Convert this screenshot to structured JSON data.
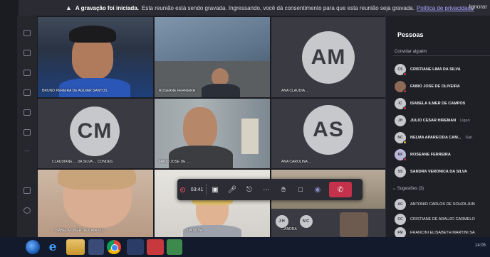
{
  "recording_bar": {
    "title": "A gravação foi iniciada.",
    "message": "Esta reunião está sendo gravada. Ingressando, você dá consentimento para que esta reunião seja gravada.",
    "privacy_link": "Política de privacidade",
    "dismiss": "Ignorar"
  },
  "tiles": [
    {
      "name": "BRUNO PEREIRA DE AGUIAR SANTOS"
    },
    {
      "name": "ROSEANE FERREIRA"
    },
    {
      "name": "ANA CLAUDIA ...",
      "initials": "AM"
    },
    {
      "name": "CLAUDIANE ... DA SILVA ... CONDES",
      "initials": "CM"
    },
    {
      "name": "FABIO JOSE DE ...",
      "initials": ""
    },
    {
      "name": "ANA CAROLINA ...",
      "initials": "AS"
    },
    {
      "name": "ISABELA ILMER DE CAMPOS"
    },
    {
      "name": "... DA SILVA"
    },
    {
      "name": "...ANDRA",
      "initials": "JH",
      "initials2": "NC"
    }
  ],
  "toolbar": {
    "timer": "03:41"
  },
  "people": {
    "title": "Pessoas",
    "invite": "Convidar alguém",
    "participants": [
      {
        "initials": "CS",
        "name": "CRISTIANE LIMA DA SILVA",
        "extra": ""
      },
      {
        "initials": "",
        "name": "FABIO JOSE DE OLIVEIRA",
        "extra": ""
      },
      {
        "initials": "IC",
        "name": "ISABELA ILMER DE CAMPOS",
        "extra": ""
      },
      {
        "initials": "JH",
        "name": "JULIO CESAR HIREMAN",
        "extra": "Ligan"
      },
      {
        "initials": "NC",
        "name": "NELMA APARECIDA CAM...",
        "extra": "Sair"
      },
      {
        "initials": "RF",
        "name": "ROSEANE FERREIRA",
        "extra": ""
      },
      {
        "initials": "SS",
        "name": "SANDRA VERONICA DA SILVA",
        "extra": ""
      }
    ],
    "suggestions_label": "Sugestões (3)",
    "suggestions": [
      {
        "initials": "AC",
        "name": "ANTONIO CARLOS DE SOUZA JUN"
      },
      {
        "initials": "CC",
        "name": "CRISTIANE DE ARAUJO CARMELO"
      },
      {
        "initials": "FM",
        "name": "FRANCINI ELISABETH MARTINI SA"
      }
    ]
  },
  "taskbar": {
    "clock": "14:05"
  },
  "colors": {
    "accent": "#6264a7",
    "hangup": "#c4314b",
    "panel": "#1f2026"
  }
}
